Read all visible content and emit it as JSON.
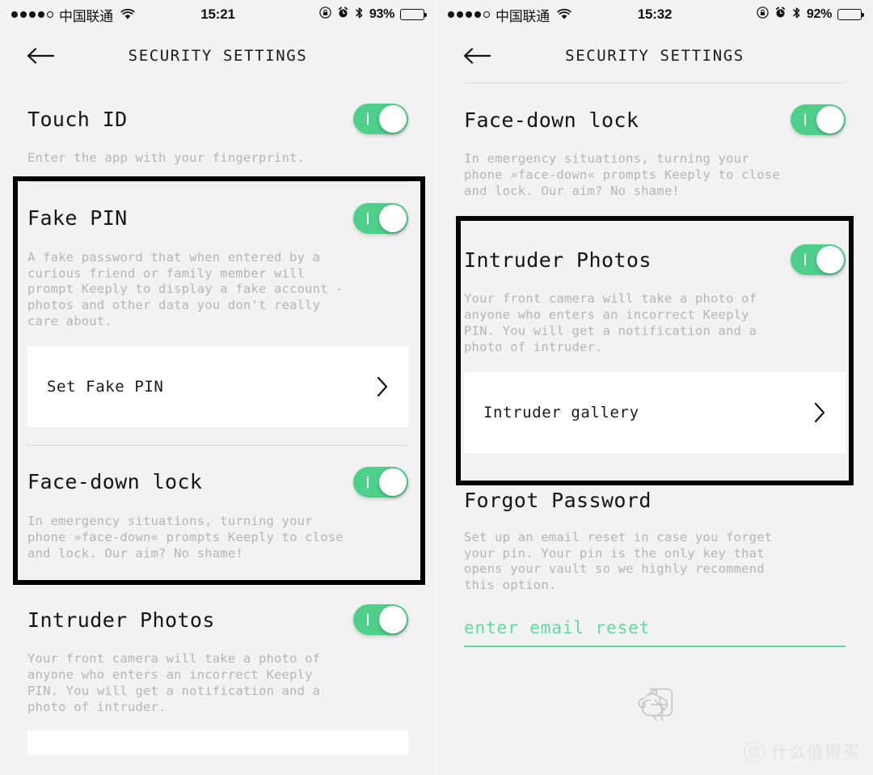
{
  "left_phone": {
    "status_bar": {
      "signal_dots_filled": 4,
      "signal_dots_total": 5,
      "carrier": "中国联通",
      "time": "15:21",
      "battery_percent": "93%",
      "icons": [
        "rotation-lock-icon",
        "alarm-icon",
        "bluetooth-icon"
      ]
    },
    "nav": {
      "back_icon": "arrow-left-icon",
      "title": "SECURITY SETTINGS"
    },
    "sections": [
      {
        "id": "touch-id",
        "title": "Touch ID",
        "description": "Enter the app with your fingerprint.",
        "toggle_on": true,
        "highlighted": false
      },
      {
        "id": "fake-pin",
        "title": "Fake PIN",
        "description": "A fake password that when entered by a\ncurious friend or family member will\nprompt Keeply to display a fake account -\nphotos and other data you don't really\ncare about.",
        "toggle_on": true,
        "highlighted": true,
        "action_row": {
          "label": "Set Fake PIN",
          "chevron": "chevron-right-icon"
        }
      },
      {
        "id": "face-down-lock",
        "title": "Face-down lock",
        "description": "In emergency situations, turning your\nphone »face-down« prompts Keeply to close\nand lock. Our aim? No shame!",
        "toggle_on": true,
        "highlighted": true
      },
      {
        "id": "intruder-photos",
        "title": "Intruder Photos",
        "description": "Your front camera will take a photo of\nanyone who enters an incorrect Keeply\nPIN. You will get a notification and a\nphoto of intruder.",
        "toggle_on": true,
        "highlighted": false
      }
    ]
  },
  "right_phone": {
    "status_bar": {
      "signal_dots_filled": 4,
      "signal_dots_total": 5,
      "carrier": "中国联通",
      "time": "15:32",
      "battery_percent": "92%",
      "icons": [
        "rotation-lock-icon",
        "alarm-icon",
        "bluetooth-icon"
      ]
    },
    "nav": {
      "back_icon": "arrow-left-icon",
      "title": "SECURITY SETTINGS"
    },
    "sections": [
      {
        "id": "face-down-lock",
        "title": "Face-down lock",
        "description": "In emergency situations, turning your\nphone »face-down« prompts Keeply to close\nand lock. Our aim? No shame!",
        "toggle_on": true,
        "highlighted": false
      },
      {
        "id": "intruder-photos",
        "title": "Intruder Photos",
        "description": "Your front camera will take a photo of\nanyone who enters an incorrect Keeply\nPIN. You will get a notification and a\nphoto of intruder.",
        "toggle_on": true,
        "highlighted": true,
        "action_row": {
          "label": "Intruder gallery",
          "chevron": "chevron-right-icon"
        }
      },
      {
        "id": "forgot-password",
        "title": "Forgot Password",
        "description": "Set up an email reset in case you forget\nyour pin. Your pin is the only key that\nopens your vault so we highly recommend\nthis option.",
        "toggle_on": false,
        "highlighted": false
      }
    ],
    "email_reset": {
      "placeholder": "enter email reset",
      "value": "",
      "accent_color": "#63d9a0"
    },
    "logo": "chameleon-logo-icon"
  },
  "watermark": {
    "badge": "值",
    "text": "什么值得买"
  },
  "colors": {
    "toggle_on": "#4ed08a",
    "accent": "#63d9a0",
    "page_bg": "#f2f2f2",
    "card_bg": "#ffffff",
    "title": "#141414",
    "description": "#b5b5b5",
    "highlight_border": "#000000"
  }
}
